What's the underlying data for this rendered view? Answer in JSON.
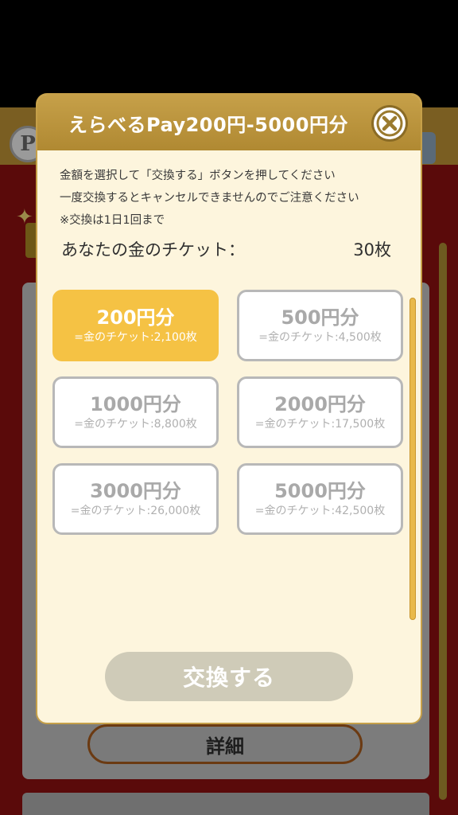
{
  "modal": {
    "title": "えらべるPay200円‐5000円分",
    "notice_lines": [
      "金額を選択して「交換する」ボタンを押してください",
      "一度交換するとキャンセルできませんのでご注意ください",
      "※交換は1日1回まで"
    ],
    "ticket_label": "あなたの金のチケット：",
    "ticket_count": "30枚",
    "options": [
      {
        "amount": "200円分",
        "cost": "=金のチケット:2,100枚",
        "selected": true
      },
      {
        "amount": "500円分",
        "cost": "=金のチケット:4,500枚",
        "selected": false
      },
      {
        "amount": "1000円分",
        "cost": "=金のチケット:8,800枚",
        "selected": false
      },
      {
        "amount": "2000円分",
        "cost": "=金のチケット:17,500枚",
        "selected": false
      },
      {
        "amount": "3000円分",
        "cost": "=金のチケット:26,000枚",
        "selected": false
      },
      {
        "amount": "5000円分",
        "cost": "=金のチケット:42,500枚",
        "selected": false
      }
    ],
    "exchange_label": "交換する",
    "close_icon": "close-icon"
  },
  "background": {
    "detail_label": "詳細",
    "coin_letter": "P"
  },
  "colors": {
    "header_gold": "#c6a049",
    "selected_yellow": "#f5c244",
    "modal_bg": "#fdf5dd",
    "button_disabled": "#cfcbb8"
  }
}
